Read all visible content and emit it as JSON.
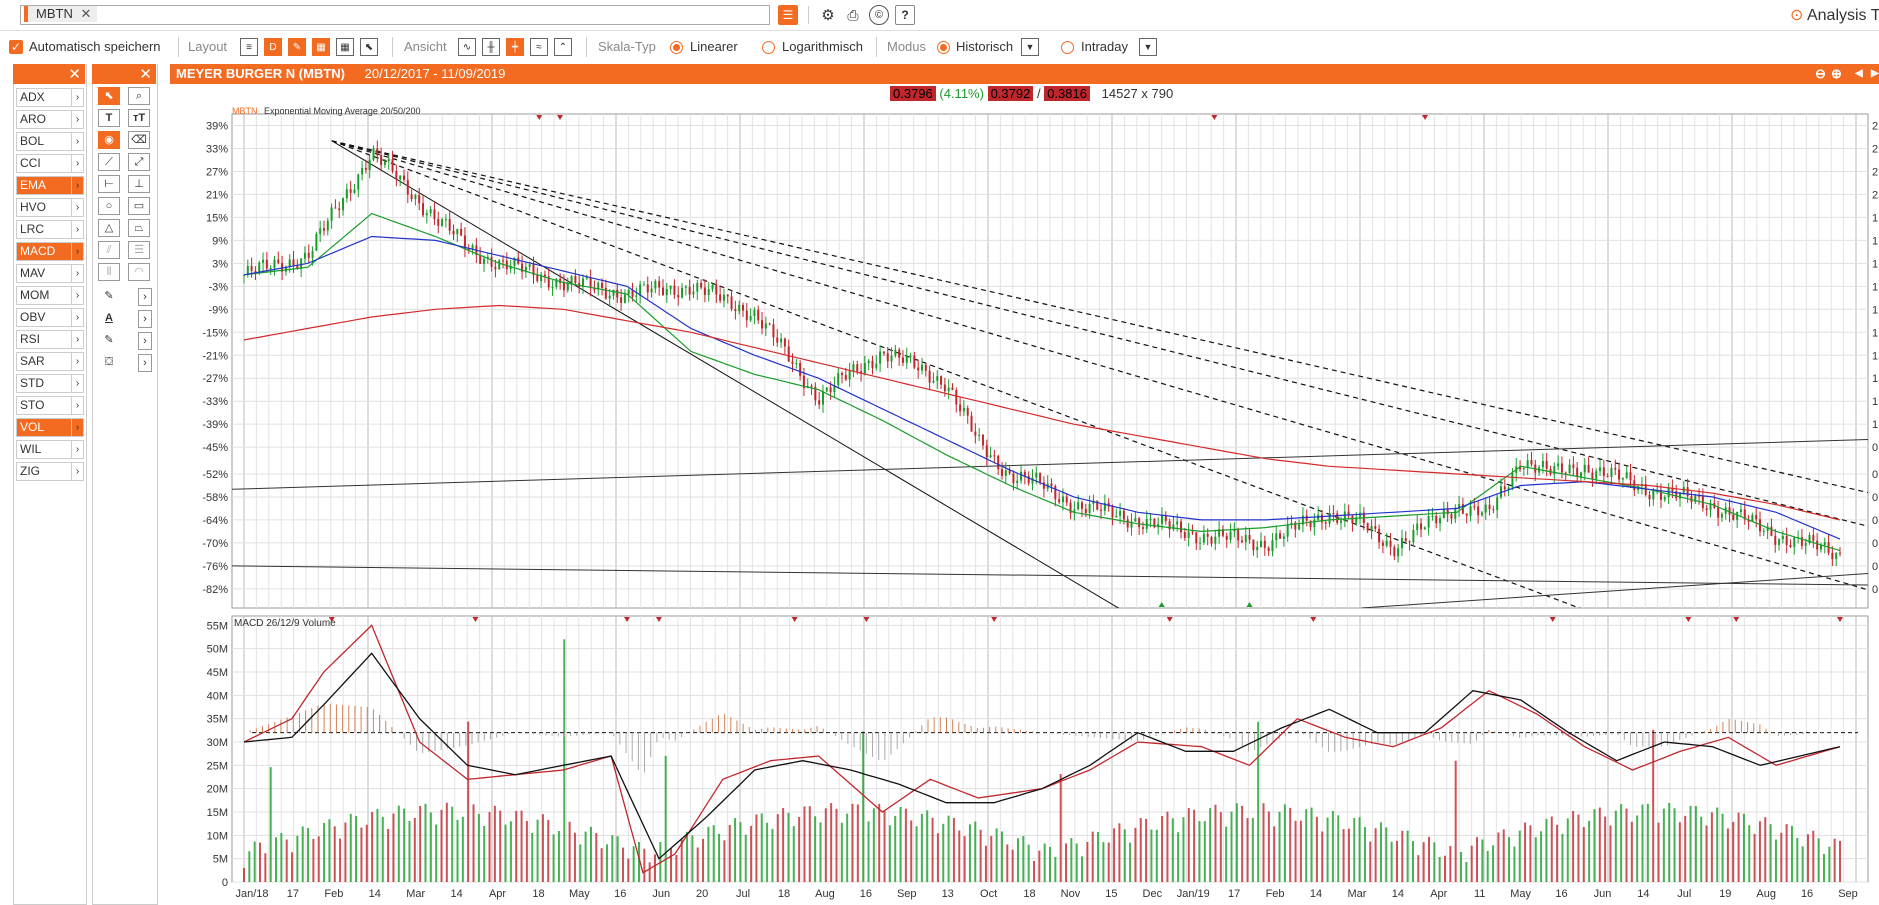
{
  "symbol": {
    "tag": "MBTN"
  },
  "topbar": {
    "analysis_label": "Analysis T"
  },
  "toolbar2": {
    "autosave_label": "Automatisch speichern",
    "layout_label": "Layout",
    "ansicht_label": "Ansicht",
    "skala_label": "Skala-Typ",
    "linear_label": "Linearer",
    "log_label": "Logarithmisch",
    "modus_label": "Modus",
    "historisch_label": "Historisch",
    "intraday_label": "Intraday"
  },
  "indicators": [
    {
      "label": "ADX",
      "active": false
    },
    {
      "label": "ARO",
      "active": false
    },
    {
      "label": "BOL",
      "active": false
    },
    {
      "label": "CCI",
      "active": false
    },
    {
      "label": "EMA",
      "active": true
    },
    {
      "label": "HVO",
      "active": false
    },
    {
      "label": "LRC",
      "active": false
    },
    {
      "label": "MACD",
      "active": true
    },
    {
      "label": "MAV",
      "active": false
    },
    {
      "label": "MOM",
      "active": false
    },
    {
      "label": "OBV",
      "active": false
    },
    {
      "label": "RSI",
      "active": false
    },
    {
      "label": "SAR",
      "active": false
    },
    {
      "label": "STD",
      "active": false
    },
    {
      "label": "STO",
      "active": false
    },
    {
      "label": "VOL",
      "active": true
    },
    {
      "label": "WIL",
      "active": false
    },
    {
      "label": "ZIG",
      "active": false
    }
  ],
  "chart": {
    "title": "MEYER BURGER N (MBTN)",
    "range": "20/12/2017 - 11/09/2019",
    "quote": {
      "v1": "0.3796",
      "pct": "(4.11%)",
      "v2": "0.3792",
      "slash": "/",
      "v3": "0.3816",
      "size": "14527 x 790"
    },
    "upper_legend_sym": "MBTN",
    "upper_legend_text": "Exponential Moving Average 20/50/200",
    "lower_legend_text": "MACD 26/12/9 Volume"
  },
  "chart_data": [
    {
      "type": "line",
      "title": "",
      "y_ticks": [
        "39%",
        "33%",
        "27%",
        "21%",
        "15%",
        "9%",
        "3%",
        "-3%",
        "-9%",
        "-15%",
        "-21%",
        "-27%",
        "-33%",
        "-39%",
        "-45%",
        "-52%",
        "-58%",
        "-64%",
        "-70%",
        "-76%",
        "-82%"
      ],
      "y_values": [
        39,
        33,
        27,
        21,
        15,
        9,
        3,
        -3,
        -9,
        -15,
        -21,
        -27,
        -33,
        -39,
        -45,
        -52,
        -58,
        -64,
        -70,
        -76,
        -82
      ],
      "ylim": [
        -87,
        42
      ],
      "right_ticks": [
        "2",
        "2",
        "2",
        "2",
        "1",
        "1",
        "1",
        "1",
        "1",
        "1",
        "1",
        "1",
        "1",
        "1",
        "0",
        "0",
        "0",
        "0",
        "0",
        "0",
        "0"
      ],
      "series": [
        {
          "name": "Price",
          "color": "#8b1a1a",
          "x": [
            0,
            4,
            8,
            12,
            14,
            16,
            20,
            24,
            28,
            32,
            36,
            40,
            44,
            46,
            48,
            50,
            52,
            56,
            60,
            64,
            68,
            70,
            72,
            74,
            76,
            78,
            80,
            82,
            84,
            86,
            88,
            92,
            96,
            100
          ],
          "y": [
            0,
            5,
            32,
            15,
            7,
            3,
            -2,
            -5,
            -3,
            -10,
            -32,
            -20,
            -28,
            -44,
            -52,
            -55,
            -60,
            -64,
            -68,
            -70,
            -62,
            -65,
            -71,
            -66,
            -60,
            -63,
            -48,
            -52,
            -50,
            -53,
            -56,
            -60,
            -68,
            -73
          ]
        },
        {
          "name": "EMA 20",
          "color": "#1a9c2b",
          "x": [
            0,
            4,
            8,
            12,
            16,
            20,
            24,
            28,
            32,
            36,
            40,
            44,
            48,
            52,
            56,
            60,
            64,
            68,
            72,
            76,
            80,
            84,
            88,
            92,
            96,
            100
          ],
          "y": [
            0,
            2,
            16,
            10,
            3,
            -2,
            -5,
            -20,
            -26,
            -30,
            -38,
            -47,
            -55,
            -62,
            -65,
            -67,
            -66,
            -64,
            -63,
            -62,
            -50,
            -53,
            -56,
            -60,
            -67,
            -72
          ]
        },
        {
          "name": "EMA 50",
          "color": "#2233cc",
          "x": [
            0,
            4,
            8,
            12,
            16,
            20,
            24,
            28,
            32,
            36,
            40,
            44,
            48,
            52,
            56,
            60,
            64,
            68,
            72,
            76,
            80,
            84,
            88,
            92,
            96,
            100
          ],
          "y": [
            0,
            3,
            10,
            9,
            5,
            1,
            -3,
            -14,
            -21,
            -27,
            -35,
            -43,
            -51,
            -58,
            -62,
            -64,
            -64,
            -63,
            -62,
            -61,
            -55,
            -54,
            -56,
            -58,
            -62,
            -69
          ]
        },
        {
          "name": "EMA 200",
          "color": "#d42a2a",
          "x": [
            0,
            4,
            8,
            12,
            16,
            20,
            24,
            28,
            32,
            36,
            40,
            44,
            48,
            52,
            56,
            60,
            64,
            68,
            72,
            76,
            80,
            84,
            88,
            92,
            96,
            100
          ],
          "y": [
            -17,
            -14,
            -11,
            -9,
            -8,
            -9,
            -12,
            -15,
            -19,
            -23,
            -27,
            -31,
            -35,
            -39,
            -42,
            -45,
            -48,
            -50,
            -51,
            -52,
            -53,
            -54,
            -55,
            -57,
            -60,
            -64
          ]
        }
      ]
    },
    {
      "type": "bar",
      "title": "",
      "y_ticks": [
        "55M",
        "50M",
        "45M",
        "40M",
        "35M",
        "30M",
        "25M",
        "20M",
        "15M",
        "10M",
        "5M",
        "0"
      ],
      "y_values": [
        55,
        50,
        45,
        40,
        35,
        30,
        25,
        20,
        15,
        10,
        5,
        0
      ],
      "ylim": [
        0,
        57
      ],
      "series": [
        {
          "name": "MACD",
          "color": "#c0272d",
          "x": [
            0,
            3,
            5,
            8,
            11,
            14,
            17,
            20,
            23,
            25,
            27,
            30,
            33,
            36,
            40,
            43,
            46,
            50,
            53,
            56,
            60,
            63,
            66,
            69,
            72,
            75,
            78,
            81,
            84,
            87,
            90,
            93,
            96,
            100
          ],
          "y": [
            30,
            35,
            45,
            55,
            30,
            22,
            23,
            24,
            27,
            2,
            6,
            22,
            26,
            27,
            15,
            22,
            18,
            20,
            24,
            30,
            29,
            25,
            35,
            31,
            29,
            33,
            41,
            36,
            29,
            24,
            28,
            31,
            25,
            29
          ]
        },
        {
          "name": "Signal",
          "color": "#111111",
          "x": [
            0,
            3,
            5,
            8,
            11,
            14,
            17,
            20,
            23,
            26,
            29,
            32,
            35,
            38,
            41,
            44,
            47,
            50,
            53,
            56,
            59,
            62,
            65,
            68,
            71,
            74,
            77,
            80,
            83,
            86,
            89,
            92,
            95,
            100
          ],
          "y": [
            30,
            31,
            38,
            49,
            35,
            25,
            23,
            25,
            27,
            5,
            14,
            24,
            26,
            24,
            21,
            17,
            17,
            20,
            25,
            32,
            28,
            28,
            33,
            37,
            32,
            32,
            41,
            39,
            32,
            26,
            30,
            29,
            25,
            29
          ]
        }
      ]
    }
  ],
  "x_axis": {
    "labels": [
      "Jan/18",
      "17",
      "Feb",
      "14",
      "Mar",
      "14",
      "Apr",
      "18",
      "May",
      "16",
      "Jun",
      "20",
      "Jul",
      "18",
      "Aug",
      "16",
      "Sep",
      "13",
      "Oct",
      "18",
      "Nov",
      "15",
      "Dec",
      "Jan/19",
      "17",
      "Feb",
      "14",
      "Mar",
      "14",
      "Apr",
      "11",
      "May",
      "16",
      "Jun",
      "14",
      "Jul",
      "19",
      "Aug",
      "16",
      "Sep"
    ]
  },
  "colors": {
    "accent": "#f36a21",
    "up": "#1a9c2b",
    "down": "#c0272d"
  }
}
